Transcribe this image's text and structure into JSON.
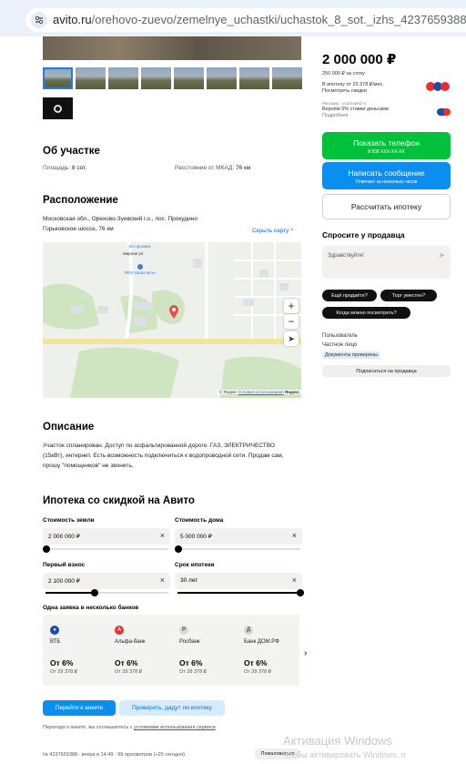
{
  "browser": {
    "url_domain": "avito.ru",
    "url_path": "/orehovo-zuevo/zemelnye_uchastki/uchastok_8_sot._izhs_4237659388"
  },
  "listing": {
    "price": "2 000 000 ₽",
    "price_per_sotka": "250 000 ₽ за сотку",
    "mortgage_line": "В ипотеку от 29 378 ₽/мес.",
    "discounts_link": "Посмотреть скидки",
    "ad_label": "Реклама · yourhoteld.ru",
    "cashback_text": "Вернём 5% ставки деньгами",
    "more_link": "Подробнее"
  },
  "actions": {
    "show_phone": "Показать телефон",
    "phone_masked": "8 938 XXX-XX-XX",
    "write_message": "Написать сообщение",
    "reply_time": "Отвечает за несколько часов",
    "calc_mortgage": "Рассчитать ипотеку"
  },
  "ask_seller": {
    "title": "Спросите у продавца",
    "message_placeholder": "Здравствуйте!",
    "chips": [
      "Ещё продаёте?",
      "Торг уместен?",
      "Когда можно посмотреть?"
    ]
  },
  "seller": {
    "name": "Пользователь",
    "type": "Частное лицо",
    "docs_badge": "Документы проверены",
    "subscribe": "Подписаться на продавца"
  },
  "about": {
    "title": "Об участке",
    "area_label": "Площадь:",
    "area_value": "8 сот.",
    "distance_label": "Расстояние от МКАД:",
    "distance_value": "76 км"
  },
  "location": {
    "title": "Расположение",
    "address": "Московская обл., Орехово-Зуевский г.о., пос. Прокудино",
    "highway": "Горьковское шоссе, 76 км",
    "hide_map": "Скрыть карту",
    "map_labels": {
      "poi1": "Эко Домики",
      "street1": "Мирная ул.",
      "poi2": "RRS Наша мгла",
      "copyright": "© Яндекс",
      "terms": "Условия использования",
      "yandex": "Яндекс"
    }
  },
  "description": {
    "title": "Описание",
    "text": "Участок спланирован. Доступ по асфальтированной дороге. ГАЗ, ЭЛЕКТРИЧЕСТВО (15кВт), интернет. Есть возможность подключиться к водопроводной сети. Продам сам, прошу \"помощников\" не звонить."
  },
  "mortgage": {
    "title": "Ипотека со скидкой на Авито",
    "land_cost_label": "Стоимость земли",
    "land_cost_value": "2 000 000 ₽",
    "land_cost_fraction": 0.01,
    "house_cost_label": "Стоимость дома",
    "house_cost_value": "5 000 000 ₽",
    "house_cost_fraction": 0.01,
    "down_payment_label": "Первый взнос",
    "down_payment_value": "2 100 000 ₽",
    "down_payment_fraction": 0.4,
    "term_label": "Срок ипотеки",
    "term_value": "30 лет",
    "term_fraction": 1.0,
    "banks_title": "Одна заявка в несколько банков",
    "banks": [
      {
        "name": "ВТБ",
        "rate": "От 6%",
        "payment": "От 29 378 ₽",
        "color": "#1a4dad",
        "glyph": "●"
      },
      {
        "name": "Альфа-банк",
        "rate": "От 6%",
        "payment": "От 29 378 ₽",
        "color": "#ef3124",
        "glyph": "А"
      },
      {
        "name": "Росбанк",
        "rate": "От 6%",
        "payment": "От 29 378 ₽",
        "color": "#d9d9d9",
        "glyph": "Р"
      },
      {
        "name": "Банк ДОМ.РФ",
        "rate": "От 6%",
        "payment": "От 29 378 ₽",
        "color": "#d9d9d9",
        "glyph": "Д"
      }
    ],
    "apply_button": "Перейти к анкете",
    "check_button": "Проверить, дадут ли ипотеку",
    "terms_prefix": "Переходя к анкете, вы соглашаетесь с",
    "terms_link": "условиями использования сервиса"
  },
  "footer": {
    "meta": "№ 4237659388 · вчера в 14:49 · 99 просмотров (+20 сегодня)",
    "complain": "Пожаловаться"
  },
  "watermark": {
    "line1": "Активация Windows",
    "line2": "Чтобы активировать Windows, п"
  }
}
